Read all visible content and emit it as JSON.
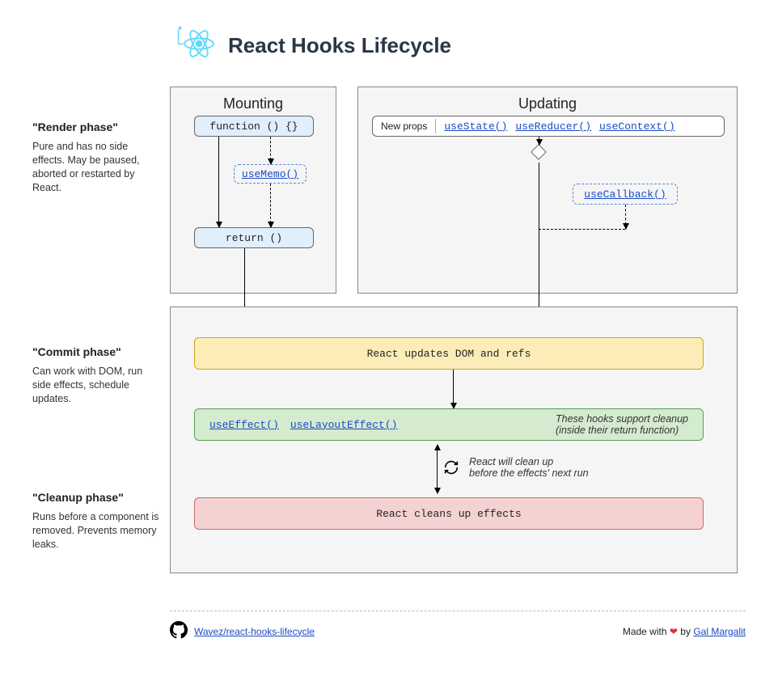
{
  "title": "React Hooks Lifecycle",
  "phases": {
    "render": {
      "title": "\"Render phase\"",
      "text": "Pure and has no side effects. May be paused, aborted or restarted by React."
    },
    "commit": {
      "title": "\"Commit phase\"",
      "text": "Can work with DOM, run side effects, schedule updates."
    },
    "cleanup": {
      "title": "\"Cleanup phase\"",
      "text": "Runs before a component is removed. Prevents memory leaks."
    }
  },
  "mounting": {
    "heading": "Mounting",
    "function_label": "function () {}",
    "usememo_label": "useMemo()",
    "return_label": "return ()"
  },
  "updating": {
    "heading": "Updating",
    "newprops_label": "New props",
    "usestate_label": "useState()",
    "usereducer_label": "useReducer()",
    "usecontext_label": "useContext()",
    "usecallback_label": "useCallback()"
  },
  "commit": {
    "updates_dom": "React updates DOM and refs",
    "useeffect_label": "useEffect()",
    "uselayouteffect_label": "useLayoutEffect()",
    "effects_note1": "These hooks support cleanup",
    "effects_note2": "(inside their return function)",
    "cleanup_note1": "React will clean up",
    "cleanup_note2": "before the effects' next run",
    "cleans_up": "React cleans up effects"
  },
  "footer": {
    "repo": "Wavez/react-hooks-lifecycle",
    "made_with": "Made with",
    "by": "by",
    "author": "Gal Margalit"
  }
}
